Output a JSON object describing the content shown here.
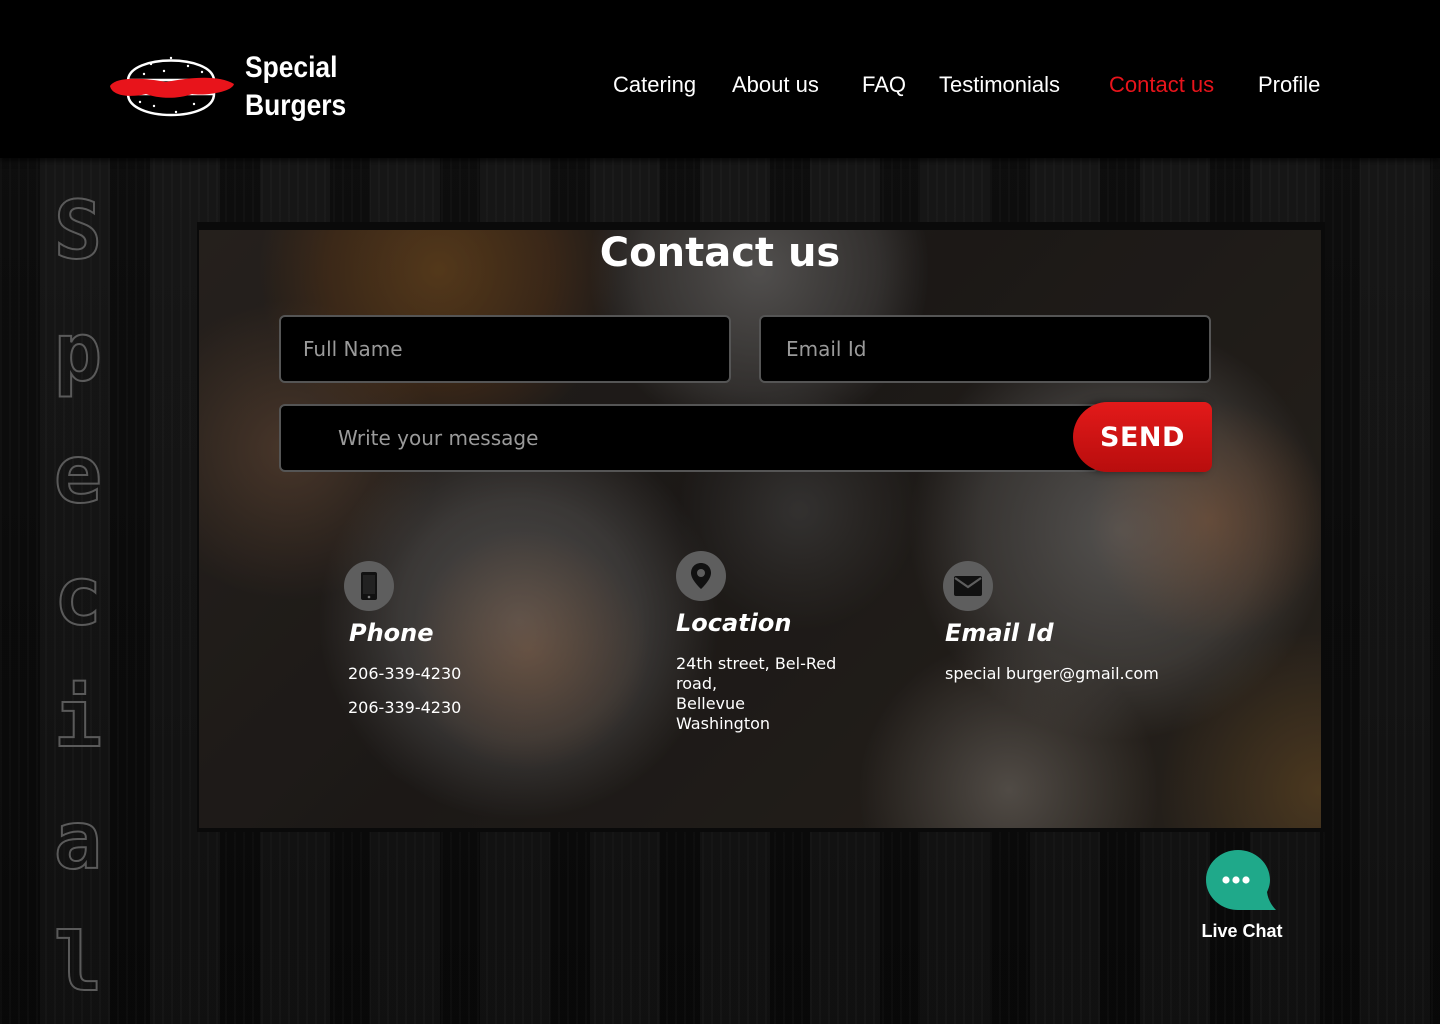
{
  "brand": {
    "name_line1": "Special",
    "name_line2": "Burgers",
    "accent_color": "#e8141b"
  },
  "nav": {
    "items": [
      {
        "label": "Catering"
      },
      {
        "label": "About us"
      },
      {
        "label": "FAQ"
      },
      {
        "label": "Testimonials"
      },
      {
        "label": "Contact us",
        "active": true
      },
      {
        "label": "Profile"
      }
    ]
  },
  "side_word": [
    "S",
    "p",
    "e",
    "c",
    "i",
    "a",
    "l"
  ],
  "page": {
    "title": "Contact us"
  },
  "form": {
    "full_name_placeholder": "Full Name",
    "email_placeholder": "Email Id",
    "message_placeholder": "Write your message",
    "send_label": "SEND"
  },
  "contact_info": {
    "phone": {
      "icon": "phone-icon",
      "title": "Phone",
      "numbers": [
        "206-339-4230",
        "206-339-4230"
      ]
    },
    "location": {
      "icon": "location-pin-icon",
      "title": "Location",
      "lines": [
        "24th street, Bel-Red",
        "road,",
        "Bellevue",
        "Washington"
      ]
    },
    "email": {
      "icon": "mail-icon",
      "title": "Email Id",
      "address": "special burger@gmail.com"
    }
  },
  "live_chat": {
    "label": "Live Chat",
    "color": "#1fa98a"
  }
}
